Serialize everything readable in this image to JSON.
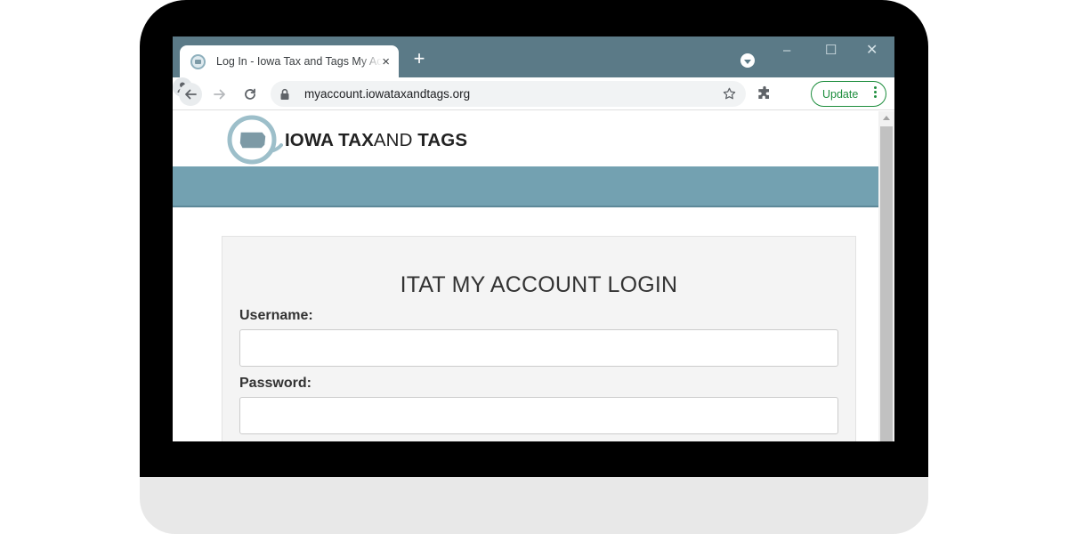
{
  "browser": {
    "tab": {
      "title": "Log In - Iowa Tax and Tags My Account",
      "favicon": "iowa-favicon-icon",
      "close": "×"
    },
    "new_tab": "+",
    "window_controls": {
      "minimize": "–",
      "maximize": "☐",
      "close": "✕"
    },
    "address_bar": {
      "url": "myaccount.iowataxandtags.org"
    },
    "update_label": "Update",
    "colors": {
      "titlebar": "#5b7a87",
      "update": "#1e8e3e"
    }
  },
  "site": {
    "logo": {
      "bold_1": "IOWA TAX",
      "thin": "AND",
      "bold_2": "TAGS"
    },
    "colors": {
      "nav": "#73a1b1"
    }
  },
  "login": {
    "title": "ITAT MY ACCOUNT LOGIN",
    "username_label": "Username:",
    "username_value": "",
    "password_label": "Password:",
    "password_value": ""
  }
}
